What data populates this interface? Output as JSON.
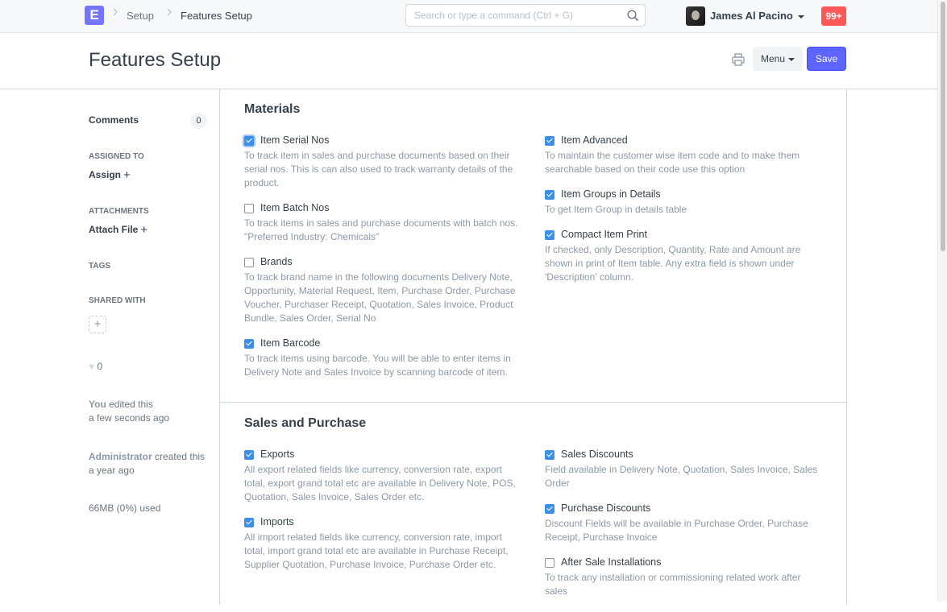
{
  "navbar": {
    "logo_letter": "E",
    "breadcrumbs": [
      "Setup",
      "Features Setup"
    ],
    "search_placeholder": "Search or type a command (Ctrl + G)",
    "user_name": "James Al Pacino",
    "notifications": "99+"
  },
  "page": {
    "title": "Features Setup",
    "menu_label": "Menu",
    "save_label": "Save"
  },
  "sidebar": {
    "comments_label": "Comments",
    "comments_count": "0",
    "assigned_to_label": "ASSIGNED TO",
    "assign_label": "Assign",
    "attachments_label": "ATTACHMENTS",
    "attach_file_label": "Attach File",
    "tags_label": "TAGS",
    "shared_with_label": "SHARED WITH",
    "likes_count": "0",
    "activity": [
      {
        "actor": "You",
        "action": " edited this",
        "when": "a few seconds ago"
      },
      {
        "actor": "Administrator",
        "action": " created this",
        "when": "a year ago"
      }
    ],
    "storage": "66MB (0%) used"
  },
  "sections": [
    {
      "title": "Materials",
      "left": [
        {
          "label": "Item Serial Nos",
          "checked": true,
          "focused": true,
          "description": "To track item in sales and purchase documents based on their serial nos. This is can also used to track warranty details of the product."
        },
        {
          "label": "Item Batch Nos",
          "checked": false,
          "description": "To track items in sales and purchase documents with batch nos. \"Preferred Industry: Chemicals\""
        },
        {
          "label": "Brands",
          "checked": false,
          "description": "To track brand name in the following documents Delivery Note, Opportunity, Material Request, Item, Purchase Order, Purchase Voucher, Purchaser Receipt, Quotation, Sales Invoice, Product Bundle, Sales Order, Serial No"
        },
        {
          "label": "Item Barcode",
          "checked": true,
          "description": "To track items using barcode. You will be able to enter items in Delivery Note and Sales Invoice by scanning barcode of item."
        }
      ],
      "right": [
        {
          "label": "Item Advanced",
          "checked": true,
          "description": "To maintain the customer wise item code and to make them searchable based on their code use this option"
        },
        {
          "label": "Item Groups in Details",
          "checked": true,
          "description": "To get Item Group in details table"
        },
        {
          "label": "Compact Item Print",
          "checked": true,
          "description": "If checked, only Description, Quantity, Rate and Amount are shown in print of Item table. Any extra field is shown under 'Description' column."
        }
      ]
    },
    {
      "title": "Sales and Purchase",
      "left": [
        {
          "label": "Exports",
          "checked": true,
          "description": "All export related fields like currency, conversion rate, export total, export grand total etc are available in Delivery Note, POS, Quotation, Sales Invoice, Sales Order etc."
        },
        {
          "label": "Imports",
          "checked": true,
          "description": "All import related fields like currency, conversion rate, import total, import grand total etc are available in Purchase Receipt, Supplier Quotation, Purchase Invoice, Purchase Order etc."
        }
      ],
      "right": [
        {
          "label": "Sales Discounts",
          "checked": true,
          "description": "Field available in Delivery Note, Quotation, Sales Invoice, Sales Order"
        },
        {
          "label": "Purchase Discounts",
          "checked": true,
          "description": "Discount Fields will be available in Purchase Order, Purchase Receipt, Purchase Invoice"
        },
        {
          "label": "After Sale Installations",
          "checked": false,
          "description": "To track any installation or commissioning related work after sales"
        }
      ]
    }
  ]
}
